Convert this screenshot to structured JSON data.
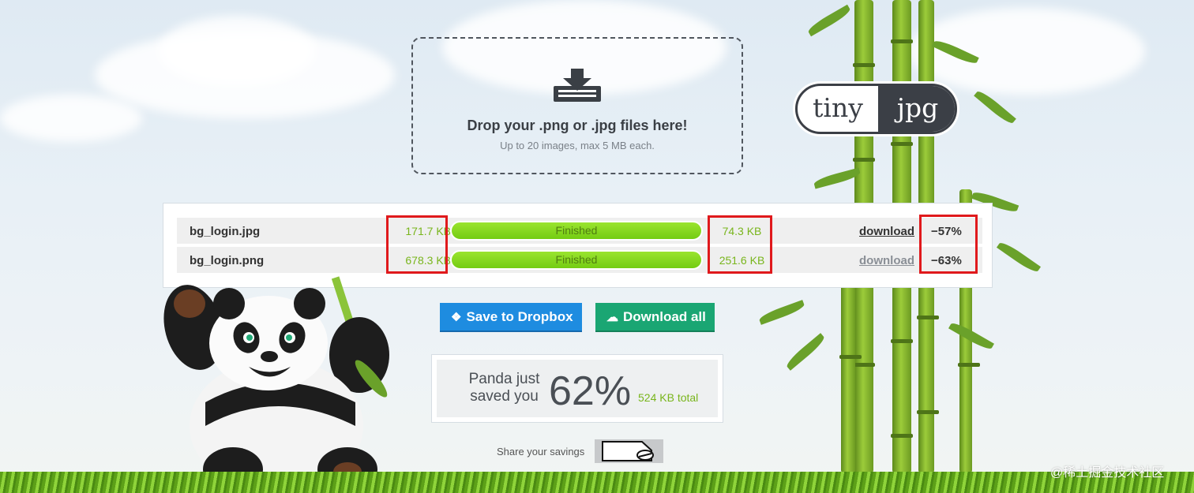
{
  "dropzone": {
    "title": "Drop your .png or .jpg files here!",
    "subtitle": "Up to 20 images, max 5 MB each."
  },
  "logo": {
    "left": "tiny",
    "right": "jpg"
  },
  "files": [
    {
      "name": "bg_login.jpg",
      "original_size": "171.7 KB",
      "status": "Finished",
      "new_size": "74.3 KB",
      "download": "download",
      "saved": "−57%",
      "progress": 1.0
    },
    {
      "name": "bg_login.png",
      "original_size": "678.3 KB",
      "status": "Finished",
      "new_size": "251.6 KB",
      "download": "download",
      "saved": "−63%",
      "progress": 1.0
    }
  ],
  "actions": {
    "dropbox_label": "Save to Dropbox",
    "download_all_label": "Download all"
  },
  "savings": {
    "label": "Panda just saved you",
    "percent": "62%",
    "total": "524 KB total"
  },
  "share": {
    "label": "Share your savings"
  },
  "watermark": "@稀土掘金技术社区",
  "colors": {
    "accent_green": "#79b51c",
    "dropbox_blue": "#1e8ce0",
    "download_teal": "#1aa673",
    "highlight_red": "#e0191c"
  },
  "icons": [
    "download-tray-icon",
    "dropbox-icon",
    "cloud-download-icon",
    "twitter-icon"
  ]
}
